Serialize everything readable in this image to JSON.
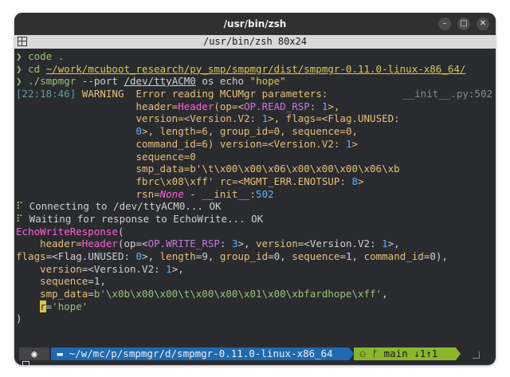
{
  "window": {
    "title": "/usr/bin/zsh",
    "tab_title": "/usr/bin/zsh 80x24"
  },
  "controls": {
    "minimize": "–",
    "maximize": "□",
    "close": "✕"
  },
  "terminal": {
    "cmd1_prompt": "❯",
    "cmd1": "code .",
    "cmd2_prompt": "❯",
    "cmd2_cmd": "cd ",
    "cmd2_path": "~/work/mcuboot_research/py_smp/smpmgr/dist/smpmgr-0.11.0-linux-x86_64/",
    "cmd3_prompt": "❯",
    "cmd3_exe": "./smpmgr",
    "cmd3_a": " --port ",
    "cmd3_dev": "/dev/ttyACM0",
    "cmd3_b": " os echo ",
    "cmd3_str": "\"hope\"",
    "log_time": "[22:18:46]",
    "log_level": "WARNING",
    "log_msg": "Error reading MCUMgr parameters:",
    "log_src": "__init__.py:502",
    "l5_a": "header=",
    "l5_b": "Header",
    "l5_c": "(op=<",
    "l5_d": "OP.READ_RSP",
    "l5_e": ": ",
    "l5_f": "1",
    "l5_g": ">,",
    "l6_a": "version=<Version.V2: ",
    "l6_b": "1",
    "l6_c": ">, ",
    "l6_d": "flags",
    "l6_e": "=<Flag.UNUSED:",
    "l7_a": "0",
    "l7_b": ">, ",
    "l7_c": "length",
    "l7_d": "=6, ",
    "l7_e": "group_id",
    "l7_f": "=0, ",
    "l7_g": "sequence",
    "l7_h": "=0,",
    "l8_a": "command_id",
    "l8_b": "=6) ",
    "l8_c": "version",
    "l8_d": "=<Version.V2: ",
    "l8_e": "1",
    "l8_f": ">",
    "l9": "sequence=0",
    "l10": "smp_data=b'\\t\\x00\\x00\\x06\\x00\\x00\\x00\\x06\\xb",
    "l11_a": "fbrc\\x08\\xff'",
    "l11_b": " rc",
    "l11_c": "=<MGMT_ERR.ENOTSUP: ",
    "l11_d": "8",
    "l11_e": ">",
    "l12_a": "rsn=",
    "l12_b": "None",
    "l12_c": " - __init__:",
    "l12_d": "502",
    "l13_a": "⠏",
    "l13_b": " Connecting to /dev/ttyACM0... OK",
    "l14_a": "⠏",
    "l14_b": " Waiting for response to EchoWrite... OK",
    "l15_a": "EchoWriteResponse",
    "l15_b": "(",
    "l16_a": "    header=",
    "l16_b": "Header",
    "l16_c": "(op=<",
    "l16_d": "OP.WRITE_RSP",
    "l16_e": ": ",
    "l16_f": "3",
    "l16_g": ">, ",
    "l16_h": "version",
    "l16_i": "=<Version.V2: ",
    "l16_j": "1",
    "l16_k": ">,",
    "l17_a": "flags",
    "l17_b": "=<Flag.UNUSED: ",
    "l17_c": "0",
    "l17_d": ">, ",
    "l17_e": "length",
    "l17_f": "=9, ",
    "l17_g": "group_id",
    "l17_h": "=0, ",
    "l17_i": "sequence",
    "l17_j": "=1, ",
    "l17_k": "command_id",
    "l17_l": "=0),",
    "l18_a": "    version",
    "l18_b": "=<Version.V2: ",
    "l18_c": "1",
    "l18_d": ">,",
    "l19_a": "    sequence",
    "l19_b": "=1,",
    "l20_a": "    smp_data",
    "l20_b": "=",
    "l20_c": "b'\\x0b\\x00\\x00\\t\\x00\\x00\\x01\\x00\\xbfardhope\\xff'",
    "l20_d": ",",
    "l21_a": "r",
    "l21_b": "=",
    "l21_c": "'hope'",
    "l22": ")"
  },
  "promptbar": {
    "os_icon": "◉",
    "path": " ▬ ~/w/mc/p/smpmgr/d/smpmgr-0.11.0-linux-x86_64 ",
    "git": " ⚇ ᚠ main ↓1↑1 "
  },
  "last_prompt": "❯"
}
